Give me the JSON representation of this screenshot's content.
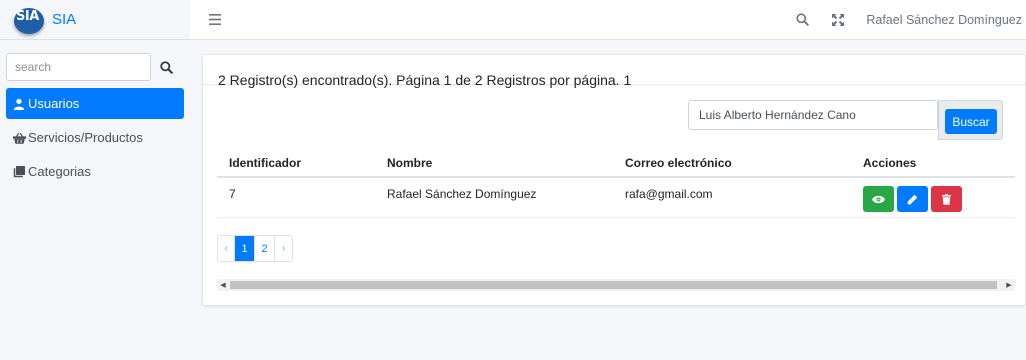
{
  "brand": {
    "logo_text": "SIA",
    "name": "SIA"
  },
  "sidebar": {
    "search": {
      "placeholder": "search"
    },
    "items": [
      {
        "label": "Usuarios",
        "icon": "user-icon",
        "active": true
      },
      {
        "label": "Servicios/Productos",
        "icon": "basket-icon",
        "active": false
      },
      {
        "label": "Categorias",
        "icon": "copy-icon",
        "active": false
      }
    ]
  },
  "topbar": {
    "user_name": "Rafael Sánchez Domínguez"
  },
  "main": {
    "records_info": "2 Registro(s) encontrado(s). Página 1 de 2 Registros por página. 1",
    "filter": {
      "value": "Luis Alberto Hernández Cano"
    },
    "search_button": "Buscar",
    "table": {
      "headers": [
        "Identificador",
        "Nombre",
        "Correo electrónico",
        "Acciones"
      ],
      "rows": [
        {
          "id": "7",
          "name": "Rafael Sánchez Domínguez",
          "email": "rafa@gmail.com"
        }
      ]
    },
    "pagination": {
      "prev": "‹",
      "pages": [
        "1",
        "2"
      ],
      "next": "›",
      "current": "1"
    }
  },
  "colors": {
    "primary": "#007bff",
    "success": "#28a745",
    "danger": "#dc3545",
    "background": "#f4f6f9"
  }
}
